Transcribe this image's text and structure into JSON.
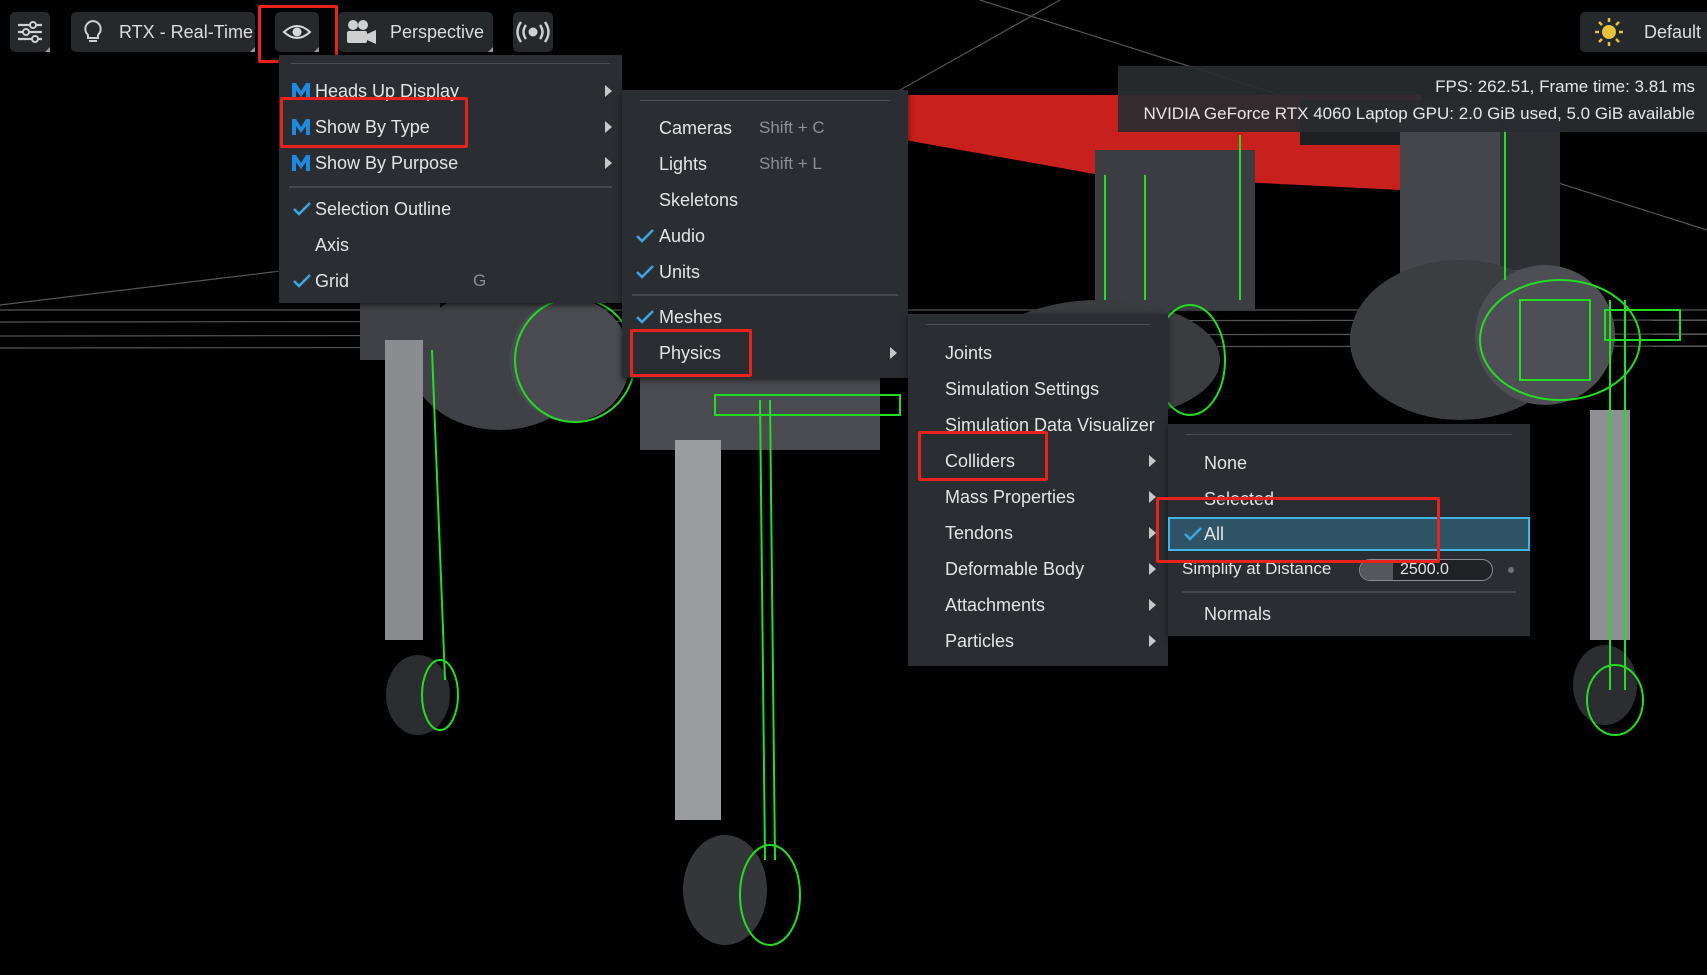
{
  "toolbar": {
    "settings_icon": "sliders-icon",
    "renderer_icon": "lightbulb-icon",
    "renderer_label": "RTX - Real-Time",
    "visibility_icon": "eye-icon",
    "camera_icon": "movie-camera-icon",
    "camera_label": "Perspective",
    "audio_icon": "broadcast-icon",
    "lighting_icon": "sun-icon",
    "lighting_label": "Default"
  },
  "stats": {
    "fps_line": "FPS: 262.51, Frame time: 3.81 ms",
    "gpu_line": "NVIDIA GeForce RTX 4060 Laptop GPU: 2.0 GiB used, 5.0 GiB available"
  },
  "menu_main": {
    "items": [
      {
        "label": "Heads Up Display"
      },
      {
        "label": "Show By Type"
      },
      {
        "label": "Show By Purpose"
      },
      {
        "label": "Selection Outline",
        "checked": true
      },
      {
        "label": "Axis"
      },
      {
        "label": "Grid",
        "shortcut": "G",
        "checked": true
      }
    ]
  },
  "menu_type": {
    "items": [
      {
        "label": "Cameras",
        "shortcut": "Shift + C"
      },
      {
        "label": "Lights",
        "shortcut": "Shift + L"
      },
      {
        "label": "Skeletons"
      },
      {
        "label": "Audio",
        "checked": true
      },
      {
        "label": "Units",
        "checked": true
      },
      {
        "label": "Meshes",
        "checked": true
      },
      {
        "label": "Physics"
      }
    ]
  },
  "menu_physics": {
    "items": [
      {
        "label": "Joints"
      },
      {
        "label": "Simulation Settings"
      },
      {
        "label": "Simulation Data Visualizer"
      },
      {
        "label": "Colliders"
      },
      {
        "label": "Mass Properties"
      },
      {
        "label": "Tendons"
      },
      {
        "label": "Deformable Body"
      },
      {
        "label": "Attachments"
      },
      {
        "label": "Particles"
      }
    ]
  },
  "menu_colliders": {
    "items": [
      {
        "label": "None"
      },
      {
        "label": "Selected"
      },
      {
        "label": "All",
        "checked": true
      },
      {
        "label": "Simplify at Distance"
      },
      {
        "label": "Normals"
      }
    ],
    "simplify_value": "2500.0",
    "simplify_fraction": 0.25
  },
  "colors": {
    "highlight_box": "#e8231d",
    "selected_row": "#2f5466",
    "selected_border": "#3fb6e6",
    "check": "#3fa3e0",
    "collider_wire": "#22dd22",
    "robot_red": "#c8201c"
  }
}
